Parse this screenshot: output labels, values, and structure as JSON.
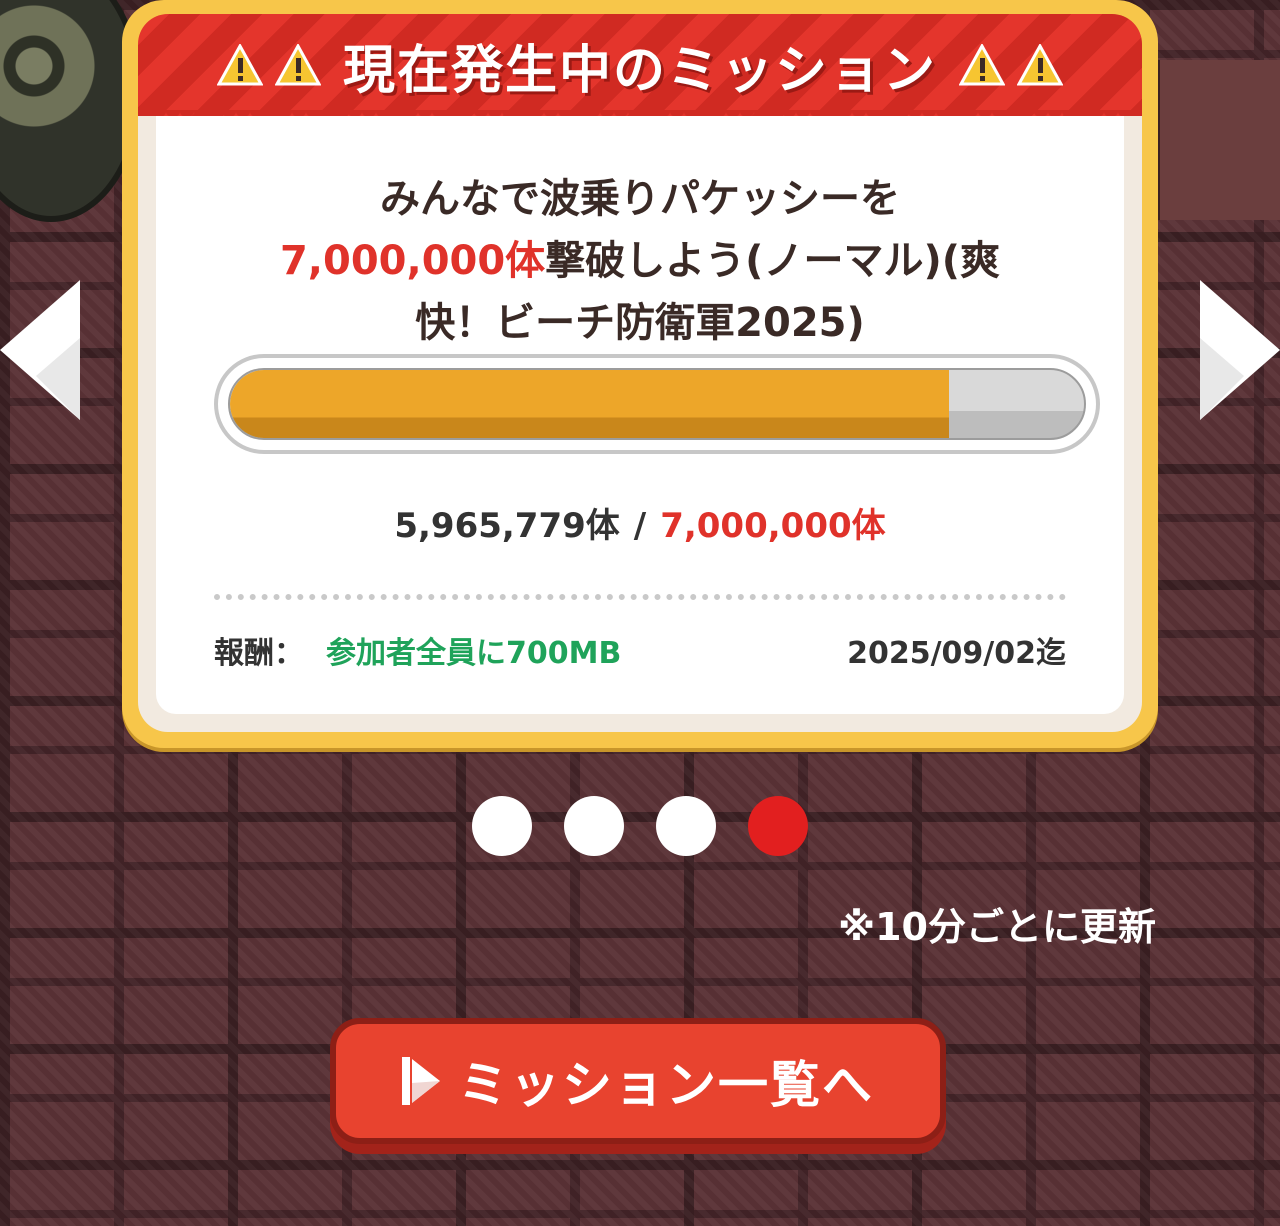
{
  "header": {
    "title": "現在発生中のミッション",
    "warning_icon": "warning-icon"
  },
  "mission": {
    "title_line1": "みんなで波乗りパケッシーを",
    "title_highlight": "7,000,000体",
    "title_line2_rest": "撃破しよう(ノーマル)(爽",
    "title_line3": "快！ビーチ防衛軍2025)",
    "progress_fraction": 0.842,
    "current": "5,965,779体",
    "separator": "/",
    "goal": "7,000,000体",
    "reward_label": "報酬：",
    "reward_value": "参加者全員に700MB",
    "deadline": "2025/09/02迄"
  },
  "pager": {
    "count": 4,
    "active_index": 3
  },
  "update_note": "※10分ごとに更新",
  "list_button": {
    "label": "ミッション一覧へ",
    "icon": "play-icon"
  },
  "colors": {
    "accent_red": "#e0322a",
    "progress_orange": "#eda629",
    "reward_green": "#1fa35a",
    "frame_yellow": "#f7c64a",
    "pager_active": "#e21f1f"
  }
}
